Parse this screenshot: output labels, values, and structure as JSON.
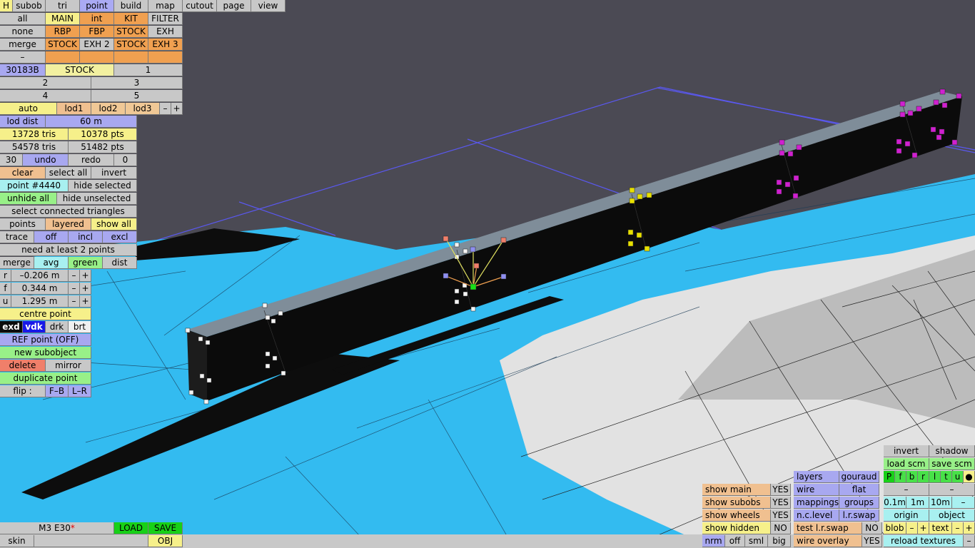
{
  "colors": {
    "viewport_bg": "#4b4a54",
    "body_blue": "#33bbf0",
    "beam": "#0b0b0b",
    "pad_purple": "#d020d0",
    "pad_yellow": "#e8e000",
    "selected_point": "#18e018"
  },
  "topmenu": {
    "h": "H",
    "subob": "subob",
    "tri": "tri",
    "point": "point",
    "build": "build",
    "map": "map",
    "cutout": "cutout",
    "page": "page",
    "view": "view"
  },
  "groups": {
    "all": "all",
    "main": "MAIN",
    "int": "int",
    "kit": "KIT",
    "filter": "FILTER",
    "none": "none",
    "rbp": "RBP",
    "fbp": "FBP",
    "stock1": "STOCK",
    "exh": "EXH",
    "merge": "merge",
    "stock2": "STOCK",
    "exh2": "EXH 2",
    "stock3": "STOCK",
    "exh3": "EXH 3",
    "dash": "–",
    "id": "30183B",
    "stock_sel": "STOCK",
    "n1": "1",
    "n2": "2",
    "n3": "3",
    "n4": "4",
    "n5": "5"
  },
  "lod": {
    "auto": "auto",
    "lod1": "lod1",
    "lod2": "lod2",
    "lod3": "lod3",
    "minus": "–",
    "plus": "+",
    "dist_label": "lod dist",
    "dist_value": "60 m"
  },
  "stats": {
    "tris_a": "13728 tris",
    "pts_a": "10378 pts",
    "tris_b": "54578 tris",
    "pts_b": "51482 pts"
  },
  "edit": {
    "undo_count": "30",
    "undo": "undo",
    "redo": "redo",
    "redo_count": "0",
    "clear": "clear",
    "select_all": "select all",
    "invert": "invert",
    "point_id": "point #4440",
    "hide_selected": "hide selected",
    "unhide_all": "unhide all",
    "hide_unselected": "hide unselected",
    "select_connected": "select connected triangles",
    "points": "points",
    "layered": "layered",
    "show_all": "show all",
    "trace": "trace",
    "off": "off",
    "incl": "incl",
    "excl": "excl",
    "need_points": "need at least 2 points",
    "merge": "merge",
    "avg": "avg",
    "green": "green",
    "dist": "dist"
  },
  "coords": {
    "r_label": "r",
    "r_value": "–0.206 m",
    "f_label": "f",
    "f_value": "0.344 m",
    "u_label": "u",
    "u_value": "1.295 m",
    "minus": "–",
    "plus": "+"
  },
  "tools": {
    "centre_point": "centre point",
    "exd": "exd",
    "vdk": "vdk",
    "drk": "drk",
    "brt": "brt",
    "ref_point": "REF point (OFF)",
    "new_subobject": "new subobject",
    "delete": "delete",
    "mirror": "mirror",
    "duplicate_point": "duplicate point",
    "flip": "flip :",
    "fb": "F–B",
    "lr": "L–R"
  },
  "file": {
    "name": "M3 E30",
    "modified": "*",
    "load": "LOAD",
    "save": "SAVE",
    "skin": "skin",
    "obj": "OBJ"
  },
  "view_opts": {
    "show_main": "show main",
    "show_main_v": "YES",
    "show_subobs": "show subobs",
    "show_subobs_v": "YES",
    "show_wheels": "show wheels",
    "show_wheels_v": "YES",
    "show_hidden": "show hidden",
    "show_hidden_v": "NO",
    "nrm": "nrm",
    "off": "off",
    "sml": "sml",
    "big": "big"
  },
  "render_opts": {
    "layers": "layers",
    "gouraud": "gouraud",
    "wire": "wire",
    "flat": "flat",
    "mappings": "mappings",
    "groups": "groups",
    "nc_level": "n.c.level",
    "lr_swap": "l.r.swap",
    "test_lr_swap": "test l.r.swap",
    "test_lr_swap_v": "NO",
    "wire_overlay": "wire overlay",
    "wire_overlay_v": "YES"
  },
  "scene_opts": {
    "invert": "invert",
    "shadow": "shadow",
    "load_scm": "load scm",
    "save_scm": "save scm",
    "flags": [
      "P",
      "f",
      "b",
      "r",
      "l",
      "t",
      "u"
    ],
    "dot": "●",
    "dash1": "–",
    "dash2": "–",
    "s01": "0.1m",
    "s1": "1m",
    "s10": "10m",
    "sminus": "–",
    "origin": "origin",
    "object": "object",
    "blob": "blob",
    "text": "text",
    "minus": "–",
    "plus": "+",
    "reload": "reload textures",
    "rminus": "–"
  }
}
